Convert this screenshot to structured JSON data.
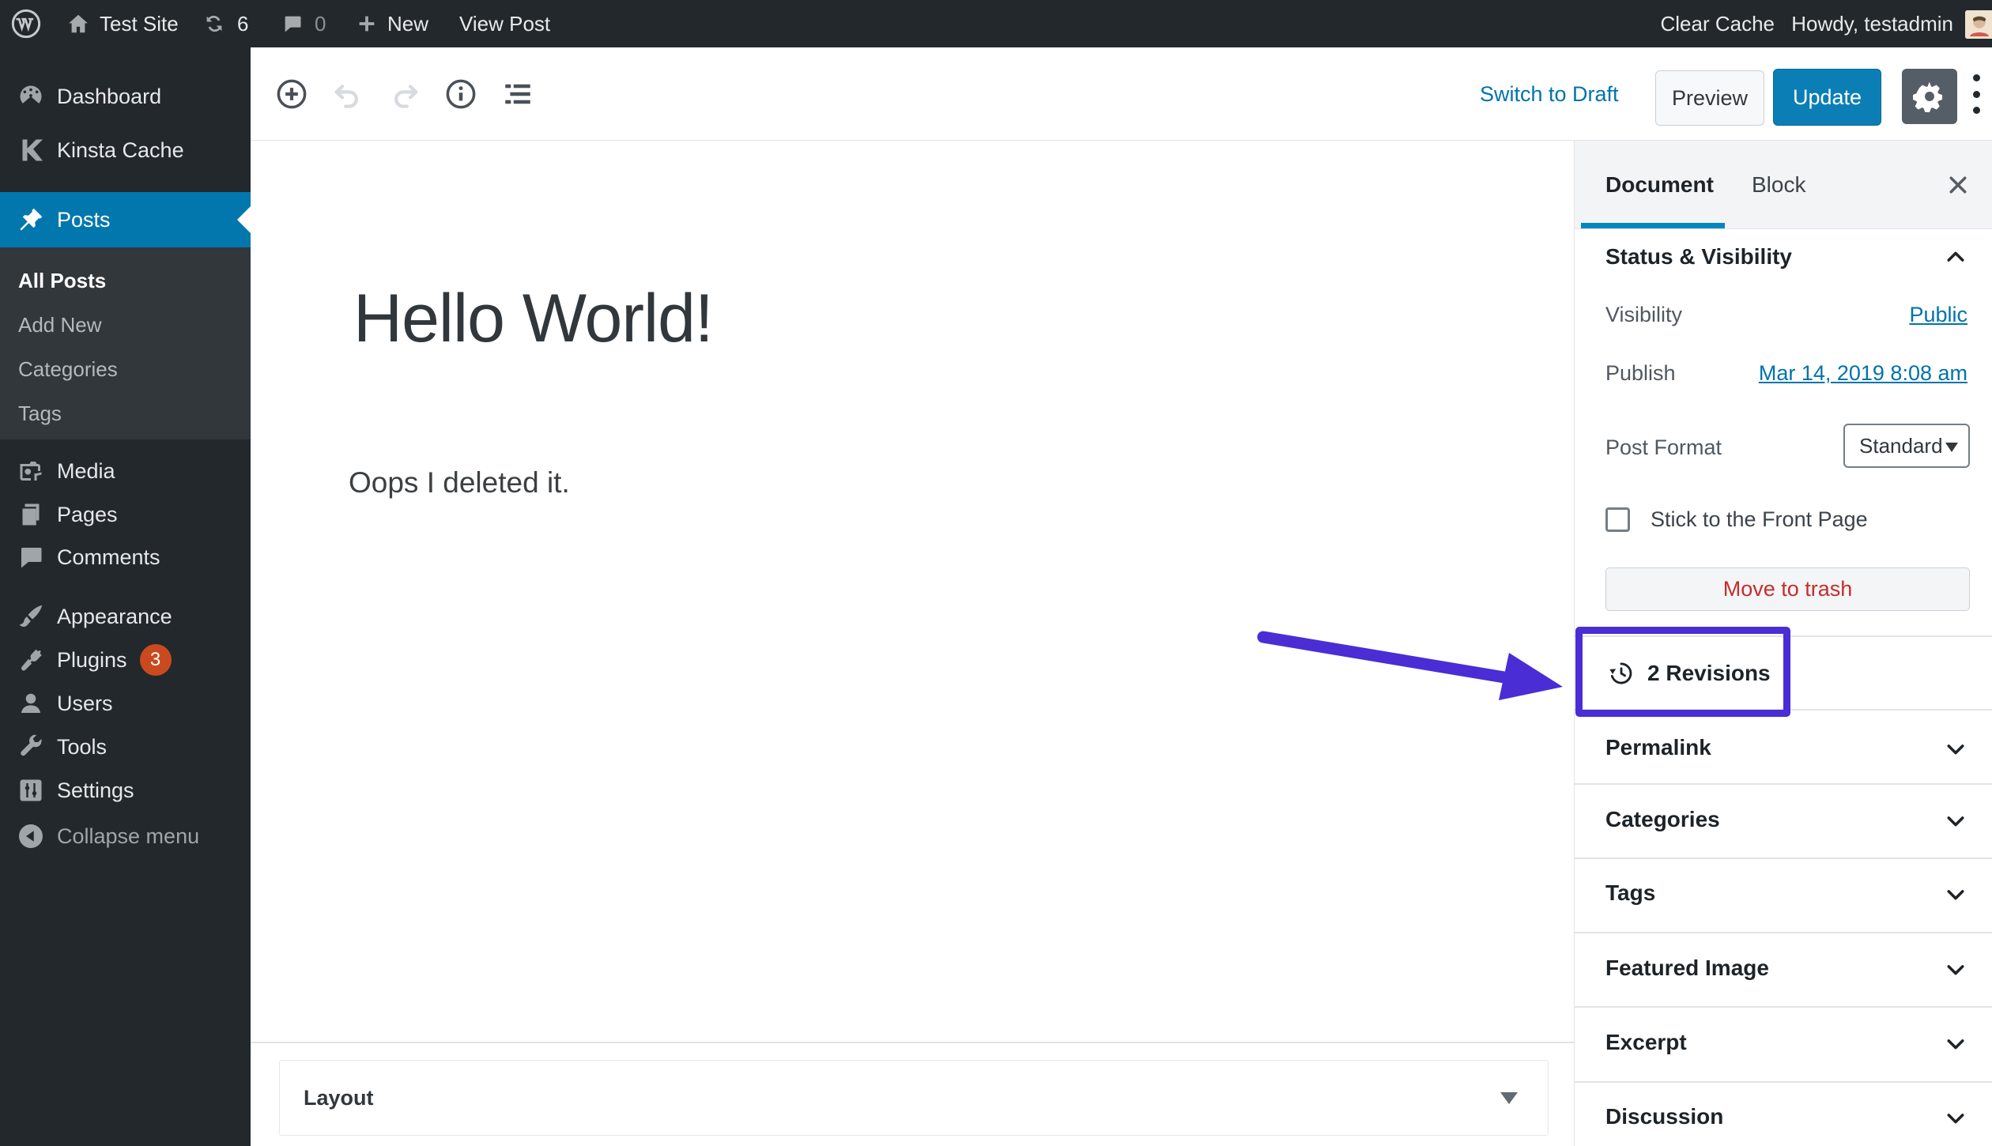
{
  "admin_bar": {
    "site_name": "Test Site",
    "updates_count": "6",
    "comments_count": "0",
    "new_label": "New",
    "view_post_label": "View Post",
    "clear_cache_label": "Clear Cache",
    "howdy_label": "Howdy, testadmin"
  },
  "sidebar": {
    "items": [
      {
        "label": "Dashboard"
      },
      {
        "label": "Kinsta Cache"
      },
      {
        "label": "Posts"
      },
      {
        "label": "Media"
      },
      {
        "label": "Pages"
      },
      {
        "label": "Comments"
      },
      {
        "label": "Appearance"
      },
      {
        "label": "Plugins"
      },
      {
        "label": "Users"
      },
      {
        "label": "Tools"
      },
      {
        "label": "Settings"
      },
      {
        "label": "Collapse menu"
      }
    ],
    "plugins_badge": "3",
    "posts_submenu": [
      {
        "label": "All Posts"
      },
      {
        "label": "Add New"
      },
      {
        "label": "Categories"
      },
      {
        "label": "Tags"
      }
    ]
  },
  "editor_header": {
    "switch_to_draft": "Switch to Draft",
    "preview": "Preview",
    "update": "Update"
  },
  "content": {
    "title": "Hello World!",
    "body": "Oops I deleted it.",
    "layout_panel_title": "Layout"
  },
  "panel": {
    "tabs": {
      "document": "Document",
      "block": "Block"
    },
    "status_visibility": {
      "title": "Status & Visibility",
      "visibility_label": "Visibility",
      "visibility_value": "Public",
      "publish_label": "Publish",
      "publish_value": "Mar 14, 2019 8:08 am",
      "post_format_label": "Post Format",
      "post_format_value": "Standard",
      "sticky_label": "Stick to the Front Page",
      "trash_label": "Move to trash",
      "revisions_label": "2 Revisions"
    },
    "sections": [
      {
        "label": "Permalink"
      },
      {
        "label": "Categories"
      },
      {
        "label": "Tags"
      },
      {
        "label": "Featured Image"
      },
      {
        "label": "Excerpt"
      },
      {
        "label": "Discussion"
      }
    ]
  },
  "colors": {
    "admin_dark": "#23282d",
    "submenu_dark": "#32373c",
    "active_menu_blue": "#0277ae",
    "link_blue": "#0073aa",
    "update_button_blue": "#0b7fb5",
    "tab_underline_blue": "#0087be",
    "plugins_badge_red": "#ca4a1f",
    "trash_red": "#c62d2d",
    "annotation_purple": "#4a2dd4",
    "divider_grey": "#e2e4e7"
  }
}
